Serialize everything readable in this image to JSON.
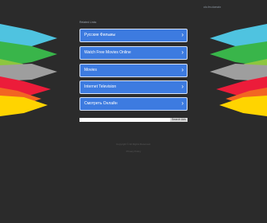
{
  "header": {
    "domain_label": "olo.fm.domain"
  },
  "related_label": "Related Links",
  "links": [
    {
      "label": "Русские Фильмы",
      "chevron": "chevron-right-icon"
    },
    {
      "label": "Watch Free Movies Online",
      "chevron": "chevron-right-icon"
    },
    {
      "label": "Movies",
      "chevron": "chevron-right-icon"
    },
    {
      "label": "Internet Television",
      "chevron": "chevron-right-icon"
    },
    {
      "label": "Смотреть Онлайн",
      "chevron": "chevron-right-icon"
    }
  ],
  "search": {
    "value": "",
    "placeholder": "",
    "button_label": "Search Ads"
  },
  "footer": {
    "line1": "Copyright © All Rights Reserved.",
    "line2": "Privacy Policy"
  },
  "colors": {
    "background": "#2b2b2b",
    "button": "#3d7be0",
    "button_border": "#d6e2f6",
    "stripes": [
      "#4fc3e0",
      "#39b54a",
      "#8dc63f",
      "#9e9e9e",
      "#ec1c3a",
      "#f26522",
      "#ffd400"
    ]
  }
}
